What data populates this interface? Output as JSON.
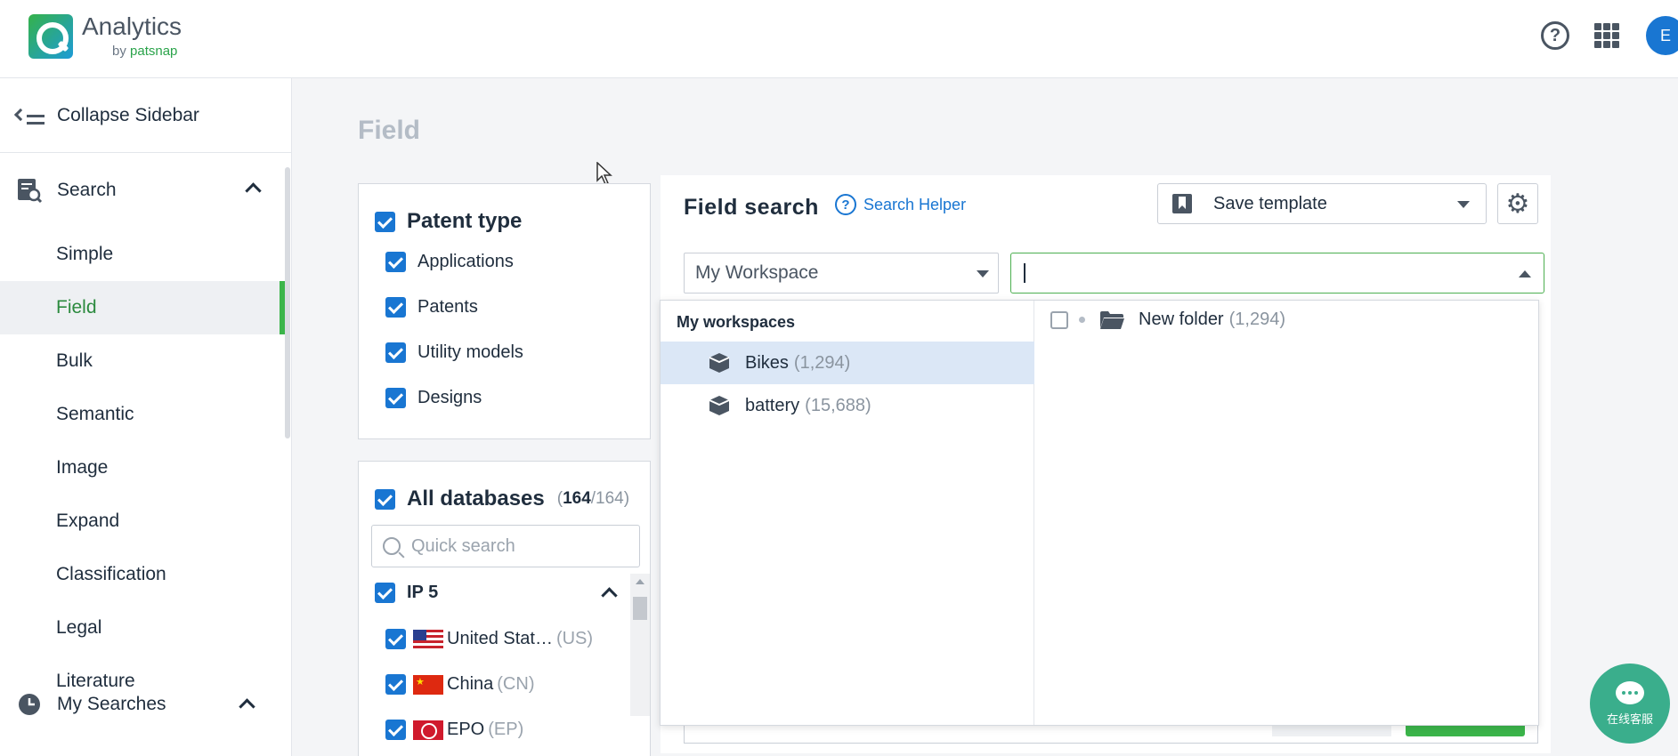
{
  "app": {
    "logo_title": "Analytics",
    "logo_by": "by",
    "logo_brand": "patsnap",
    "avatar_initial": "E"
  },
  "sidebar": {
    "collapse_label": "Collapse Sidebar",
    "search_section": "Search",
    "items": [
      {
        "label": "Simple"
      },
      {
        "label": "Field",
        "active": true
      },
      {
        "label": "Bulk"
      },
      {
        "label": "Semantic"
      },
      {
        "label": "Image"
      },
      {
        "label": "Expand"
      },
      {
        "label": "Classification"
      },
      {
        "label": "Legal"
      },
      {
        "label": "Literature"
      }
    ],
    "my_searches": "My Searches"
  },
  "page": {
    "title": "Field"
  },
  "patent_type": {
    "heading": "Patent type",
    "options": [
      "Applications",
      "Patents",
      "Utility models",
      "Designs"
    ]
  },
  "databases": {
    "heading": "All databases",
    "selected": "164",
    "total": "/164",
    "quick_search_placeholder": "Quick search",
    "group": "IP 5",
    "countries": [
      {
        "name": "United Stat…",
        "code": "(US)"
      },
      {
        "name": "China",
        "code": "(CN)"
      },
      {
        "name": "EPO",
        "code": "(EP)"
      }
    ]
  },
  "field_search": {
    "title": "Field search",
    "helper": "Search Helper",
    "save_template": "Save template",
    "workspace_select": "My Workspace",
    "folder_input_value": ""
  },
  "workspace_dropdown": {
    "heading": "My workspaces",
    "workspaces": [
      {
        "name": "Bikes",
        "count": "(1,294)",
        "selected": true
      },
      {
        "name": "battery",
        "count": "(15,688)",
        "selected": false
      }
    ],
    "folders": [
      {
        "name": "New folder",
        "count": "(1,294)"
      }
    ]
  },
  "chat": {
    "label": "在线客服"
  },
  "colors": {
    "accent_green": "#3bb54a",
    "primary_blue": "#1976d2",
    "selected_row": "#dbe7f6"
  }
}
